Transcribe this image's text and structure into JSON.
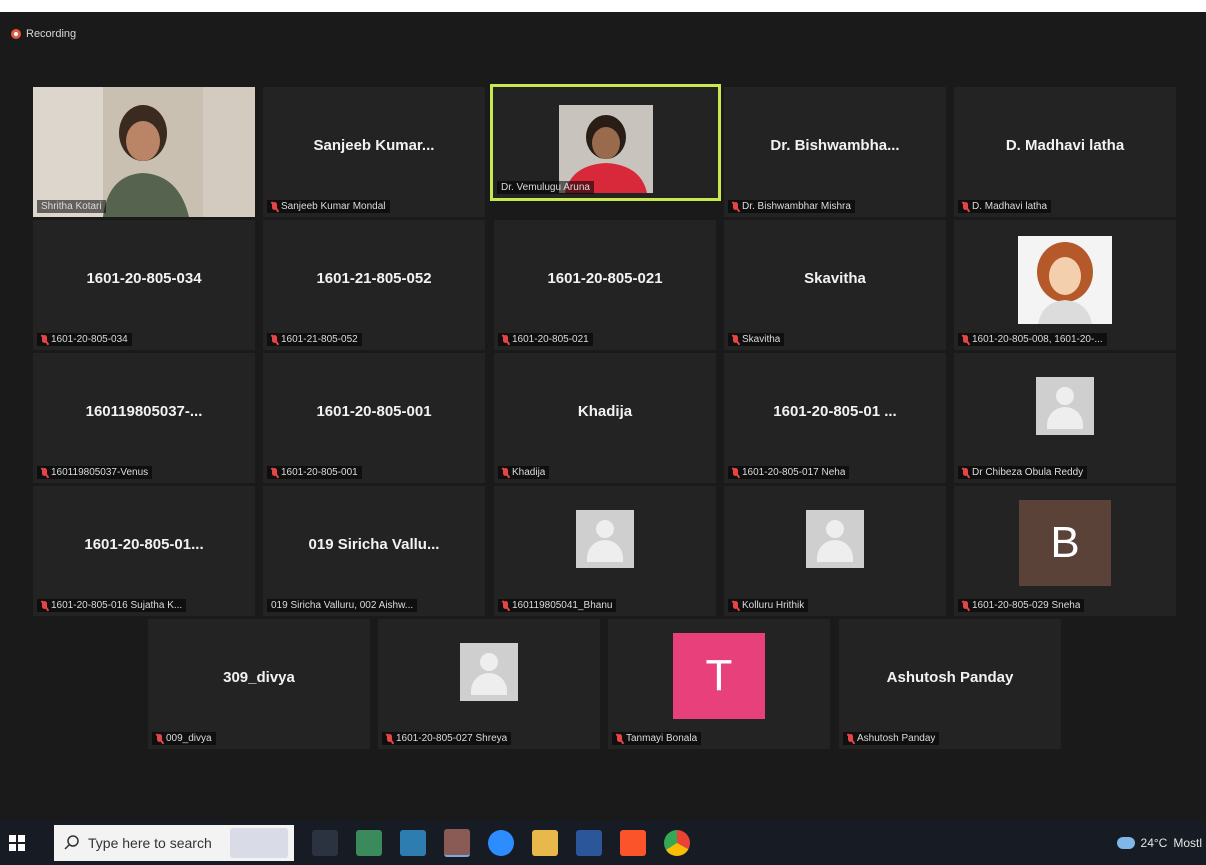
{
  "recording": {
    "label": "Recording"
  },
  "tiles": [
    {
      "big": "",
      "label": "Shritha Kotari"
    },
    {
      "big": "Sanjeeb  Kumar...",
      "label": "Sanjeeb Kumar Mondal"
    },
    {
      "big": "",
      "label": "Dr. Vemulugu Aruna"
    },
    {
      "big": "Dr.  Bishwambha...",
      "label": "Dr. Bishwambhar Mishra"
    },
    {
      "big": "D. Madhavi latha",
      "label": "D. Madhavi latha"
    },
    {
      "big": "1601-20-805-034",
      "label": "1601-20-805-034"
    },
    {
      "big": "1601-21-805-052",
      "label": "1601-21-805-052"
    },
    {
      "big": "1601-20-805-021",
      "label": "1601-20-805-021"
    },
    {
      "big": "Skavitha",
      "label": "Skavitha"
    },
    {
      "big": "",
      "label": "1601-20-805-008, 1601-20-..."
    },
    {
      "big": "160119805037-...",
      "label": "160119805037-Venus"
    },
    {
      "big": "1601-20-805-001",
      "label": "1601-20-805-001"
    },
    {
      "big": "Khadija",
      "label": "Khadija"
    },
    {
      "big": "1601-20-805-01 ...",
      "label": "1601-20-805-017 Neha"
    },
    {
      "big": "",
      "label": "Dr Chibeza Obula Reddy"
    },
    {
      "big": "1601-20-805-01...",
      "label": "1601-20-805-016 Sujatha K..."
    },
    {
      "big": "019  Siricha  Vallu...",
      "label": "019 Siricha Valluru, 002 Aishw..."
    },
    {
      "big": "",
      "label": "160119805041_Bhanu"
    },
    {
      "big": "",
      "label": "Kolluru Hrithik"
    },
    {
      "big": "",
      "letter": "B",
      "label": "1601-20-805-029 Sneha"
    },
    {
      "big": "309_divya",
      "label": "009_divya"
    },
    {
      "big": "",
      "label": "1601-20-805-027 Shreya"
    },
    {
      "big": "",
      "letter": "T",
      "label": "Tanmayi Bonala"
    },
    {
      "big": "Ashutosh Panday",
      "label": "Ashutosh Panday"
    }
  ],
  "taskbar": {
    "search_placeholder": "Type here to search",
    "weather": "24°C",
    "weather_desc": "Mostl"
  },
  "colors": {
    "active_speaker": "#c7e84f",
    "avatar_b": "#5b4238",
    "avatar_t": "#e8407a",
    "tile_bg": "#232323",
    "muted_mic": "#e54545"
  }
}
